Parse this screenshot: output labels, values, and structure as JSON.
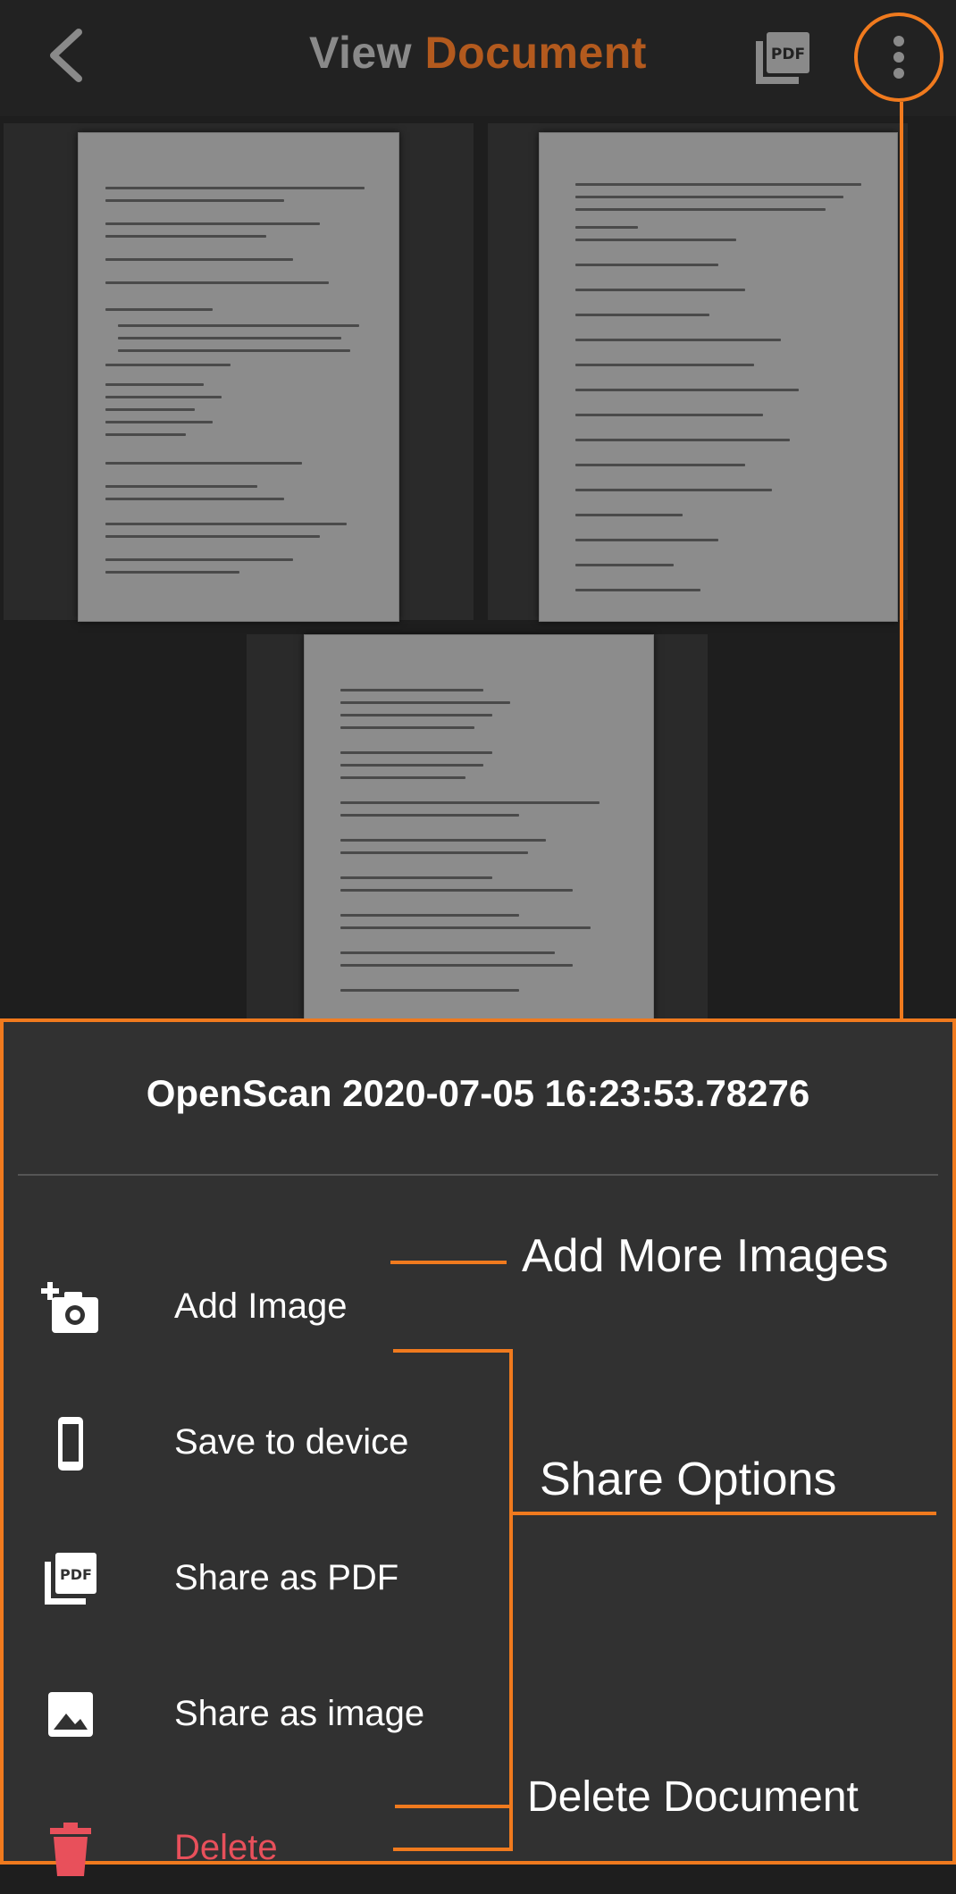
{
  "header": {
    "title_part1": "View",
    "title_part2": "Document",
    "back_icon": "arrow-back-icon",
    "pdf_icon": "pdf-icon",
    "more_icon": "more-vert-icon"
  },
  "menu": {
    "document_name": "OpenScan 2020-07-05 16:23:53.78276",
    "items": [
      {
        "label": "Add Image",
        "icon": "add-photo-icon"
      },
      {
        "label": "Save to device",
        "icon": "phone-icon"
      },
      {
        "label": "Share as PDF",
        "icon": "pdf-icon"
      },
      {
        "label": "Share as image",
        "icon": "image-icon"
      },
      {
        "label": "Delete",
        "icon": "trash-icon"
      }
    ]
  },
  "annotations": {
    "add_more": "Add More Images",
    "share_options": "Share Options",
    "delete_document": "Delete Document"
  },
  "colors": {
    "accent": "#f07a1e",
    "title_accent": "#b35a1e",
    "delete": "#e8505b",
    "sheet_bg": "#313131"
  }
}
